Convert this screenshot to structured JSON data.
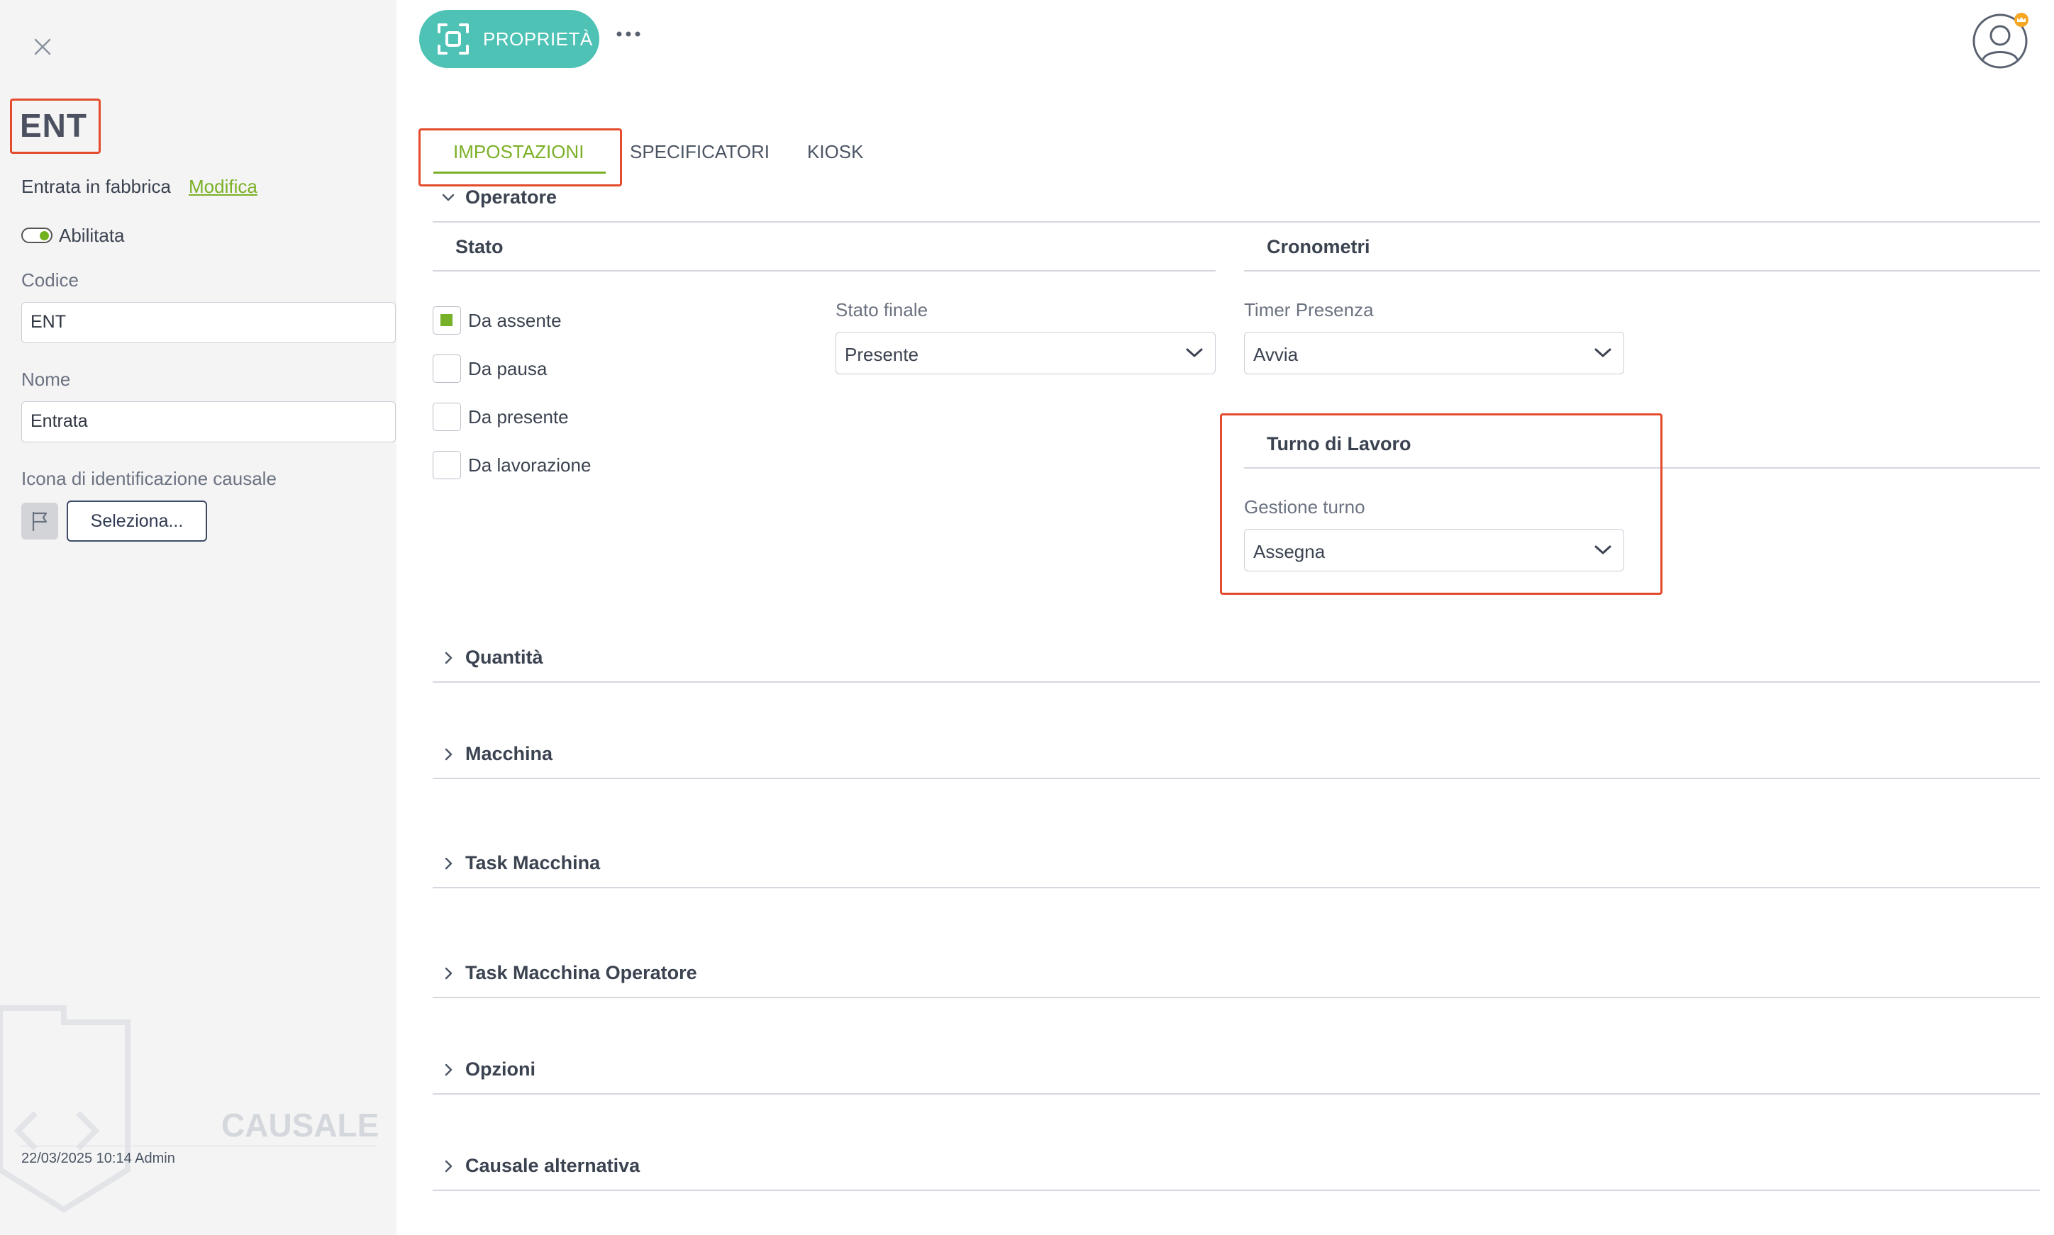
{
  "left_panel": {
    "title": "ENT",
    "subtitle": "Entrata in fabbrica",
    "edit_link": "Modifica",
    "enabled_label": "Abilitata",
    "code_label": "Codice",
    "code_value": "ENT",
    "name_label": "Nome",
    "name_value": "Entrata",
    "icon_label": "Icona di identificazione causale",
    "select_button": "Seleziona...",
    "watermark_text": "CAUSALE",
    "footer": "22/03/2025 10:14 Admin"
  },
  "header": {
    "properties_button": "PROPRIETÀ"
  },
  "tabs": [
    {
      "label": "IMPOSTAZIONI",
      "active": true
    },
    {
      "label": "SPECIFICATORI",
      "active": false
    },
    {
      "label": "KIOSK",
      "active": false
    }
  ],
  "operatore": {
    "title": "Operatore",
    "expanded": true,
    "stato": {
      "title": "Stato",
      "checkboxes": [
        {
          "label": "Da assente",
          "checked": true
        },
        {
          "label": "Da pausa",
          "checked": false
        },
        {
          "label": "Da presente",
          "checked": false
        },
        {
          "label": "Da lavorazione",
          "checked": false
        }
      ],
      "final_state_label": "Stato finale",
      "final_state_value": "Presente"
    },
    "cronometri": {
      "title": "Cronometri",
      "timer_label": "Timer Presenza",
      "timer_value": "Avvia"
    },
    "turno": {
      "title": "Turno di Lavoro",
      "shift_label": "Gestione turno",
      "shift_value": "Assegna"
    }
  },
  "sections": [
    {
      "title": "Quantità"
    },
    {
      "title": "Macchina"
    },
    {
      "title": "Task Macchina"
    },
    {
      "title": "Task Macchina Operatore"
    },
    {
      "title": "Opzioni"
    },
    {
      "title": "Causale alternativa"
    }
  ],
  "colors": {
    "accent_green": "#7bb026",
    "teal_button": "#4ec2b5",
    "highlight_red": "#e44b2c",
    "sidebar_bg": "#f4f4f5"
  }
}
